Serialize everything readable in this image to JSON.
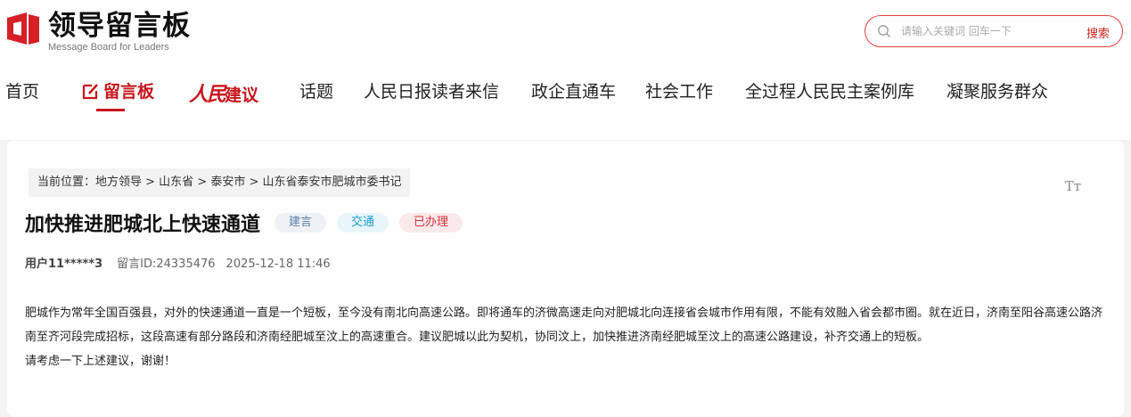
{
  "logo": {
    "cn": "领导留言板",
    "en": "Message Board for Leaders"
  },
  "search": {
    "placeholder": "请输入关键词 回车一下",
    "button": "搜索"
  },
  "nav": {
    "items": [
      {
        "label": "首页"
      },
      {
        "label": "留言板"
      },
      {
        "label": "人民建议",
        "script": "人民",
        "rest": "建议"
      },
      {
        "label": "话题"
      },
      {
        "label": "人民日报读者来信"
      },
      {
        "label": "政企直通车"
      },
      {
        "label": "社会工作"
      },
      {
        "label": "全过程人民民主案例库"
      },
      {
        "label": "凝聚服务群众"
      }
    ]
  },
  "breadcrumb": "当前位置：地方领导 > 山东省 > 泰安市 > 山东省泰安市肥城市委书记",
  "font_toggle": "Tт",
  "article": {
    "title": "加快推进肥城北上快速通道",
    "tags": [
      "建言",
      "交通",
      "已办理"
    ],
    "user": "用户11*****3",
    "message_id": "留言ID:24335476",
    "datetime": "2025-12-18 11:46",
    "body": "肥城作为常年全国百强县，对外的快速通道一直是一个短板，至今没有南北向高速公路。即将通车的济微高速走向对肥城北向连接省会城市作用有限，不能有效融入省会都市圈。就在近日，济南至阳谷高速公路济南至齐河段完成招标，这段高速有部分路段和济南经肥城至汶上的高速重合。建议肥城以此为契机，协同汶上，加快推进济南经肥城至汶上的高速公路建设，补齐交通上的短板。",
    "closing": "请考虑一下上述建议，谢谢！"
  },
  "colors": {
    "brand": "#c8161d",
    "search_border": "#e0403a"
  }
}
